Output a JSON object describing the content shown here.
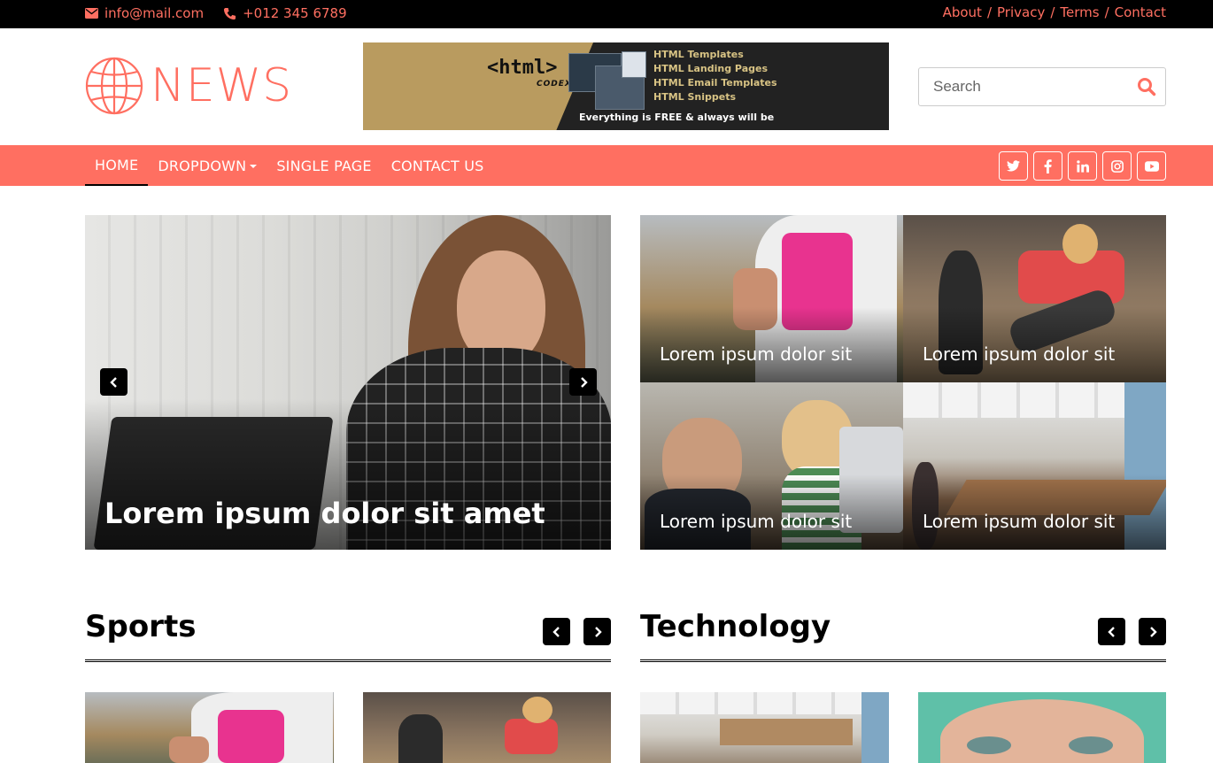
{
  "topbar": {
    "email": "info@mail.com",
    "phone": "+012 345 6789",
    "links": [
      "About",
      "Privacy",
      "Terms",
      "Contact"
    ]
  },
  "logo": {
    "text": "NEWS"
  },
  "banner": {
    "brand": "<html>",
    "brand_sub": "CODEX",
    "items": [
      "HTML Templates",
      "HTML Landing Pages",
      "HTML Email Templates",
      "HTML Snippets"
    ],
    "tagline": "Everything is FREE & always will be"
  },
  "search": {
    "placeholder": "Search"
  },
  "nav": {
    "items": [
      "HOME",
      "DROPDOWN",
      "SINGLE PAGE",
      "CONTACT US"
    ],
    "active": "HOME"
  },
  "social": [
    "twitter-icon",
    "facebook-icon",
    "linkedin-icon",
    "instagram-icon",
    "youtube-icon"
  ],
  "hero": {
    "caption": "Lorem ipsum dolor sit amet"
  },
  "tiles": [
    {
      "caption": "Lorem ipsum dolor sit"
    },
    {
      "caption": "Lorem ipsum dolor sit"
    },
    {
      "caption": "Lorem ipsum dolor sit"
    },
    {
      "caption": "Lorem ipsum dolor sit"
    }
  ],
  "sections": [
    {
      "title": "Sports"
    },
    {
      "title": "Technology"
    }
  ],
  "colors": {
    "accent": "#ff6f61",
    "dark": "#000000"
  }
}
